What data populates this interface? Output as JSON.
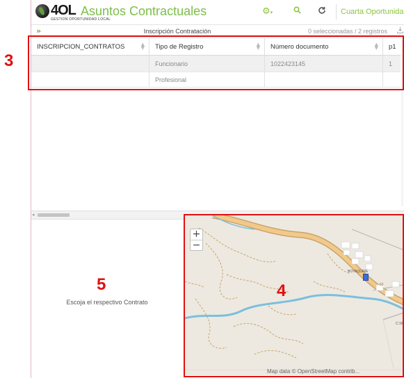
{
  "header": {
    "logo_text": "4OL",
    "logo_subtext": "GESTION OPORTUNIDAD LOCAL",
    "app_title": "Asuntos Contractuales",
    "icons": [
      "gear-icon",
      "search-icon",
      "refresh-icon"
    ],
    "user_name": "Cuarta Oportunida",
    "user_caret": "▼"
  },
  "panel": {
    "expand_icon": "»",
    "title": "Inscripción Contratación",
    "selection_count": "0 seleccionadas / 2 registros",
    "export_icon": "download-icon"
  },
  "grid": {
    "columns": [
      "INSCRIPCION_CONTRATOS",
      "Tipo de Registro",
      "Número documento",
      "p1"
    ],
    "rows": [
      [
        "",
        "Funcionario",
        "1022423145",
        "1"
      ],
      [
        "",
        "Profesional",
        "",
        ""
      ]
    ]
  },
  "info_panel": {
    "message": "Escoja el respectivo Contrato"
  },
  "map": {
    "zoom_in": "+",
    "zoom_out": "−",
    "place_label": "BOYAQUIRE",
    "road_label": "60",
    "road_label_2": "C:16",
    "attribution": "Map data © OpenStreetMap contrib..."
  },
  "annotations": {
    "grid_number": "3",
    "map_number": "4",
    "info_number": "5"
  },
  "colors": {
    "accent": "#7bbf47",
    "annotation": "#e01010",
    "river": "#6fb7d6",
    "road": "#e8bf7f"
  }
}
